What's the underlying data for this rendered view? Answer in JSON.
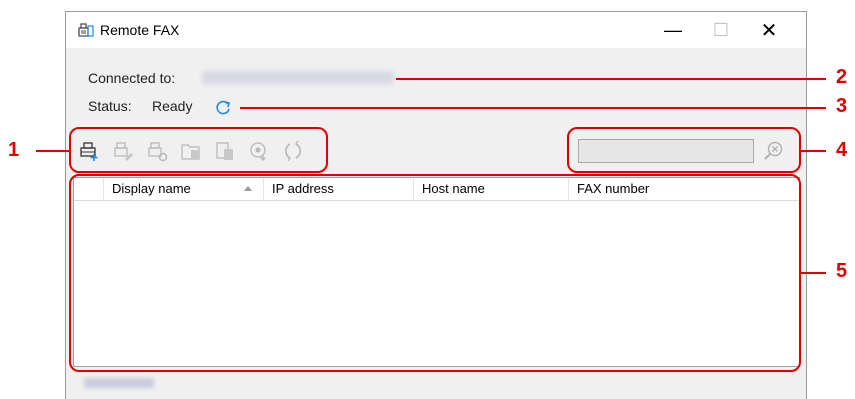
{
  "window": {
    "title": "Remote FAX",
    "controls": {
      "minimize": "—",
      "maximize": "☐",
      "close": "✕"
    }
  },
  "info": {
    "connected_label": "Connected to:",
    "status_label": "Status:",
    "status_value": "Ready"
  },
  "toolbar": {
    "buttons": [
      "add-device-icon",
      "edit-device-icon",
      "device-settings-icon",
      "import-icon",
      "export-icon",
      "download-icon",
      "sync-icon"
    ]
  },
  "table": {
    "columns": [
      "Display name",
      "IP address",
      "Host name",
      "FAX number"
    ],
    "rows": []
  },
  "callouts": [
    "1",
    "2",
    "3",
    "4",
    "5"
  ],
  "colors": {
    "callout": "#e00000",
    "accent": "#1e88e5"
  }
}
